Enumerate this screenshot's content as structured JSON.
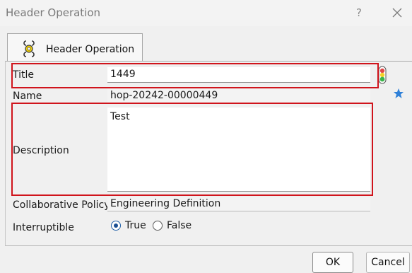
{
  "window": {
    "title": "Header Operation",
    "help_label": "?"
  },
  "tab": {
    "label": "Header Operation",
    "icon": "header-operation-icon"
  },
  "form": {
    "title": {
      "label": "Title",
      "value": "1449"
    },
    "name": {
      "label": "Name",
      "value": "hop-20242-00000449"
    },
    "description": {
      "label": "Description",
      "value": "Test"
    },
    "collab_policy": {
      "label": "Collaborative Policy",
      "value": "Engineering Definition"
    },
    "interruptible": {
      "label": "Interruptible",
      "options": [
        "True",
        "False"
      ],
      "selected": "True"
    }
  },
  "buttons": {
    "ok": "OK",
    "cancel": "Cancel"
  },
  "colors": {
    "highlight_box": "#d0141c",
    "favorite_star": "#2f80d8",
    "status_light": "#3ab54a"
  }
}
